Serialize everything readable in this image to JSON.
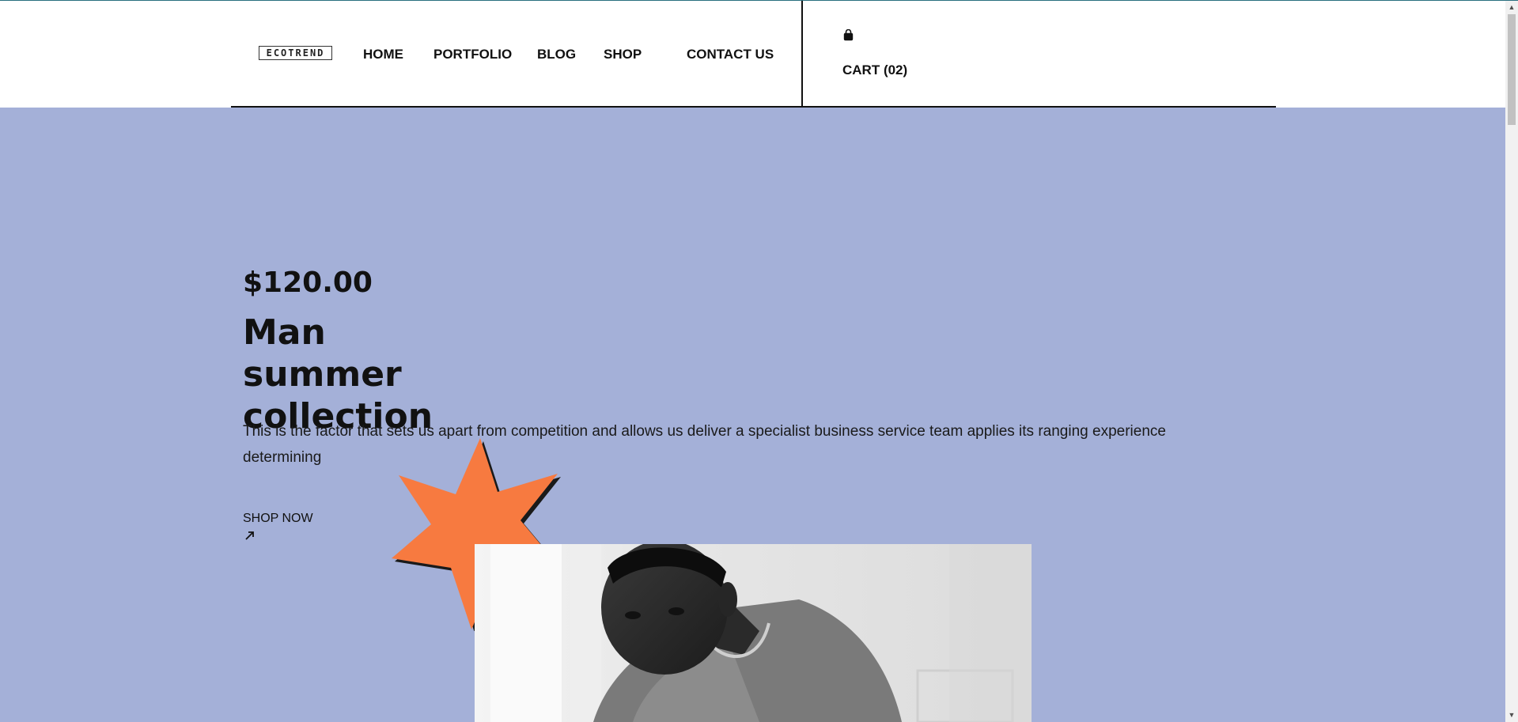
{
  "header": {
    "logo_text": "ECOTREND",
    "nav": [
      {
        "label": "HOME"
      },
      {
        "label": "PORTFOLIO"
      },
      {
        "label": "BLOG"
      },
      {
        "label": "SHOP"
      },
      {
        "label": "CONTACT US"
      }
    ],
    "cart_label": "CART (02)",
    "cart_icon": "shopping-bag-icon"
  },
  "hero": {
    "price": "$120.00",
    "title": "Man summer collection",
    "description": "This is the factor that sets us apart from competition and allows us deliver a specialist business service team applies its ranging experience determining",
    "cta_label": "SHOP NOW",
    "cta_icon": "arrow-up-right-icon",
    "background_color": "#a4b0d8",
    "star_color": "#f77a40"
  },
  "scrollbar": {
    "up_glyph": "▲",
    "down_glyph": "▼"
  }
}
